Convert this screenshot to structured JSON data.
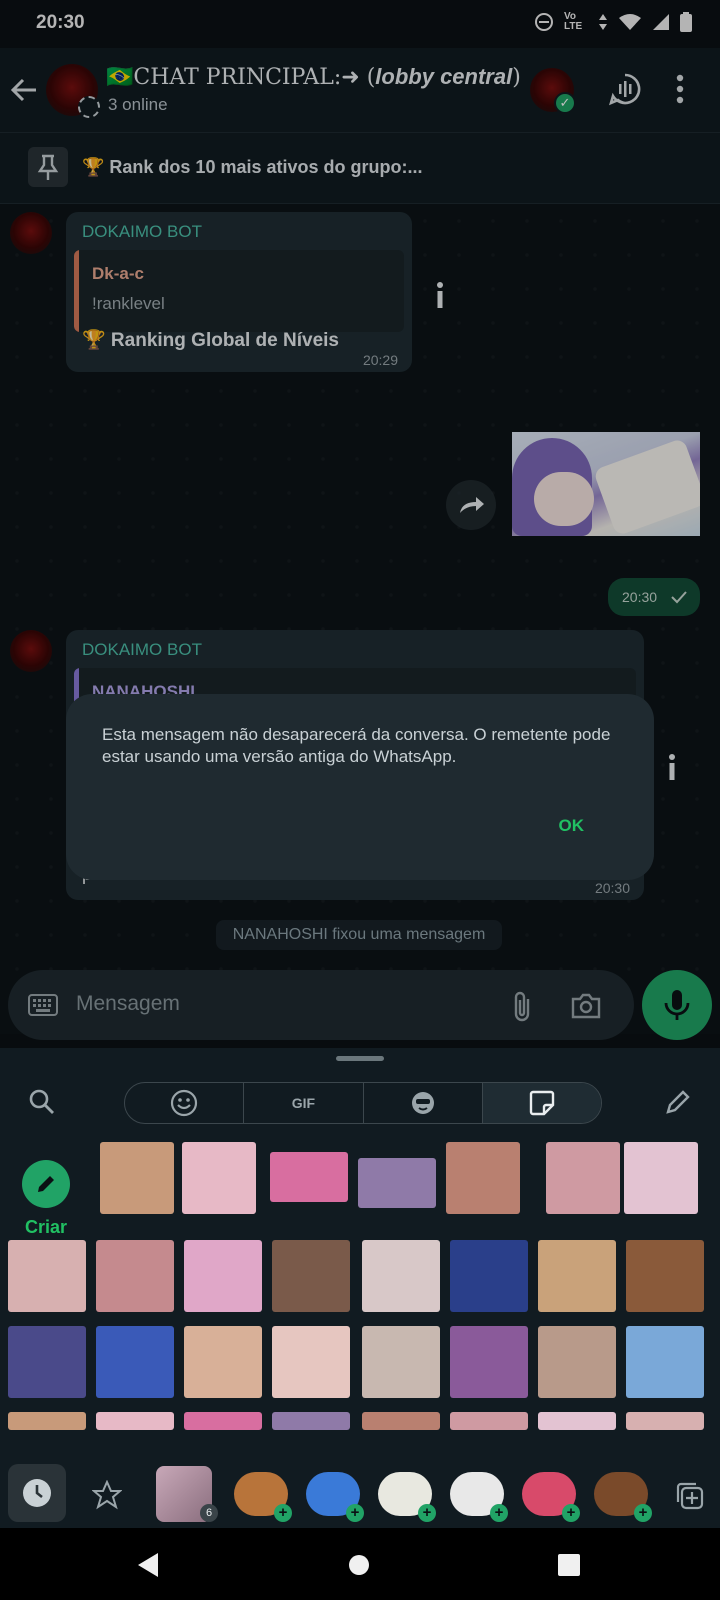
{
  "status_bar": {
    "time": "20:30",
    "network": "Vo LTE"
  },
  "header": {
    "title_prefix": "🇧🇷CHAT PRINCIPAL:➜ (",
    "title_italic": "lobby central",
    "title_suffix": ")",
    "subtitle": "3 online"
  },
  "pinned": {
    "text": "🏆 Rank dos 10 mais ativos do grupo:..."
  },
  "messages": [
    {
      "sender": "DOKAIMO BOT",
      "quote_name": "Dk-a-c",
      "quote_text": "!ranklevel",
      "text": "🏆 Ranking Global de Níveis",
      "time": "20:29"
    },
    {
      "type": "outgoing-image",
      "time": "20:30"
    },
    {
      "sender": "DOKAIMO BOT",
      "quote_name": "NANAHOSHI",
      "text_tail": "precisa do teu vibe.",
      "time": "20:30"
    }
  ],
  "system_message": "NANAHOSHI fixou uma mensagem",
  "dialog": {
    "text": "Esta mensagem não desaparecerá da conversa. O remetente pode estar usando uma versão antiga do WhatsApp.",
    "ok": "OK"
  },
  "input": {
    "placeholder": "Mensagem"
  },
  "sticker_panel": {
    "tabs": [
      "emoji",
      "GIF",
      "avatar",
      "stickers"
    ],
    "gif_label": "GIF",
    "create_label": "Criar",
    "pack_badge": "6"
  },
  "colors": {
    "accent": "#21c063",
    "bubble_in": "#1f2c33",
    "bubble_out": "#134d37",
    "bg": "#0c1317"
  }
}
